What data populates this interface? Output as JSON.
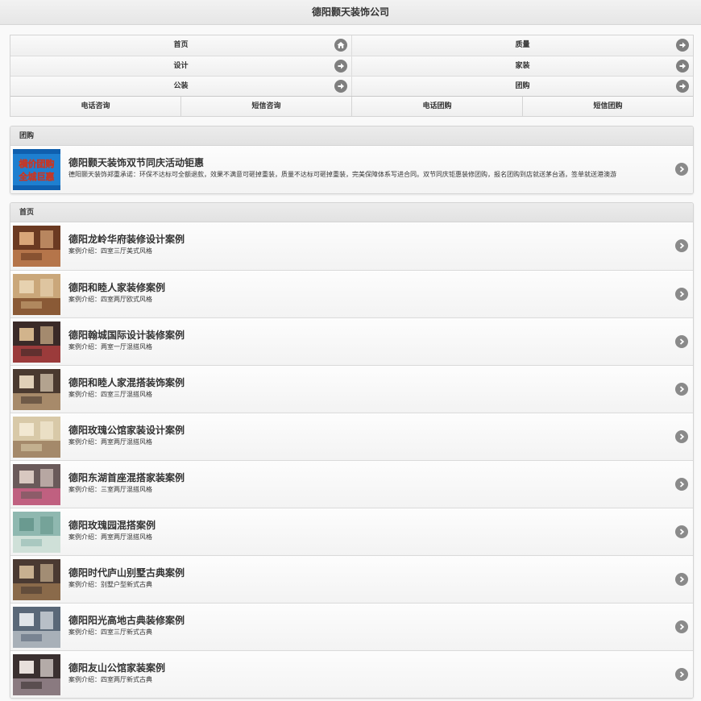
{
  "header": {
    "title": "德阳颢天装饰公司"
  },
  "nav": {
    "rows": [
      [
        {
          "label": "首页",
          "icon": "home-icon"
        },
        {
          "label": "质量",
          "icon": "arrow-right-icon"
        }
      ],
      [
        {
          "label": "设计",
          "icon": "arrow-right-icon"
        },
        {
          "label": "家装",
          "icon": "arrow-right-icon"
        }
      ],
      [
        {
          "label": "公装",
          "icon": "arrow-right-icon"
        },
        {
          "label": "团购",
          "icon": "arrow-right-icon"
        }
      ]
    ],
    "actions": [
      "电话咨询",
      "短信咨询",
      "电话团购",
      "短信团购"
    ]
  },
  "group": {
    "heading": "团购",
    "items": [
      {
        "title": "德阳颢天装饰双节同庆活动钜惠",
        "desc": "德阳颢天装饰郑重承诺：环保不达标可全额退款，效果不满意可砸掉重装，质量不达标可砸掉重装，完美保障体系写进合同。双节同庆钜惠装修团购，报名团购到店就送茅台酒，签单就送港澳游",
        "banner_line1": "横价团购",
        "banner_line2": "全城巨惠"
      }
    ]
  },
  "home": {
    "heading": "首页",
    "items": [
      {
        "title": "德阳龙岭华府装修设计案例",
        "desc": "案例介绍：四室三厅美式风格"
      },
      {
        "title": "德阳和睦人家装修案例",
        "desc": "案例介绍：四室两厅欧式风格"
      },
      {
        "title": "德阳翰城国际设计装修案例",
        "desc": "案例介绍：两室一厅混搭风格"
      },
      {
        "title": "德阳和睦人家混搭装饰案例",
        "desc": "案例介绍：四室三厅混搭风格"
      },
      {
        "title": "德阳玫瑰公馆家装设计案例",
        "desc": "案例介绍：两室两厅混搭风格"
      },
      {
        "title": "德阳东湖首座混搭家装案例",
        "desc": "案例介绍：三室两厅混搭风格"
      },
      {
        "title": "德阳玫瑰园混搭案例",
        "desc": "案例介绍：两室两厅混搭风格"
      },
      {
        "title": "德阳时代庐山别墅古典案例",
        "desc": "案例介绍：别墅户型新式古典"
      },
      {
        "title": "德阳阳光高地古典装修案例",
        "desc": "案例介绍：四室三厅新式古典"
      },
      {
        "title": "德阳友山公馆家装案例",
        "desc": "案例介绍：四室两厅新式古典"
      }
    ]
  },
  "colors": {
    "icon_bg": "#7f7f7f",
    "banner_bg": "#1e7fd0",
    "banner_text": "#ffd21a"
  }
}
